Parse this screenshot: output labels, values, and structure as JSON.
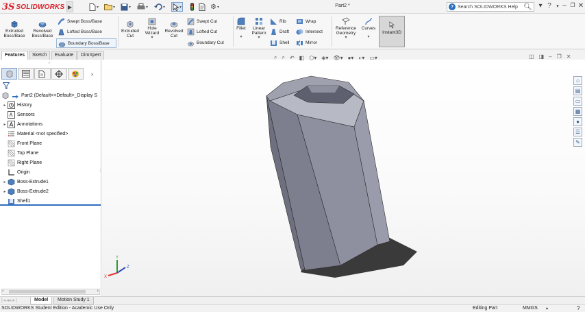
{
  "app": {
    "logo_prefix": "3S",
    "logo_text": "SOLIDWORKS",
    "doc_title": "Part2 *"
  },
  "search": {
    "placeholder": "Search SOLIDWORKS Help"
  },
  "commands": {
    "extruded_boss": "Extruded Boss/Base",
    "revolved_boss": "Revolved Boss/Base",
    "swept_boss": "Swept Boss/Base",
    "lofted_boss": "Lofted Boss/Base",
    "boundary_boss": "Boundary Boss/Base",
    "extruded_cut": "Extruded Cut",
    "hole_wizard": "Hole Wizard",
    "revolved_cut": "Revolved Cut",
    "swept_cut": "Swept Cut",
    "lofted_cut": "Lofted Cut",
    "boundary_cut": "Boundary Cut",
    "fillet": "Fillet",
    "linear_pattern": "Linear Pattern",
    "rib": "Rib",
    "draft": "Draft",
    "shell": "Shell",
    "wrap": "Wrap",
    "intersect": "Intersect",
    "mirror": "Mirror",
    "reference_geometry": "Reference Geometry",
    "curves": "Curves",
    "instant3d": "Instant3D"
  },
  "tabs": [
    "Features",
    "Sketch",
    "Evaluate",
    "DimXpert"
  ],
  "tree": {
    "root": "Part2  (Default<<Default>_Display S",
    "items": [
      "History",
      "Sensors",
      "Annotations",
      "Material <not specified>",
      "Front Plane",
      "Top Plane",
      "Right Plane",
      "Origin",
      "Boss-Extrude1",
      "Boss-Extrude2",
      "Shell1"
    ]
  },
  "bottom_tabs": [
    "Model",
    "Motion Study 1"
  ],
  "status": {
    "left": "SOLIDWORKS Student Edition - Academic Use Only",
    "editing": "Editing Part",
    "units": "MMGS"
  },
  "colors": {
    "accent": "#d8202a",
    "model_face": "#8a8c9c",
    "model_top": "#b9bbc7",
    "shadow": "#3a3a3a"
  }
}
